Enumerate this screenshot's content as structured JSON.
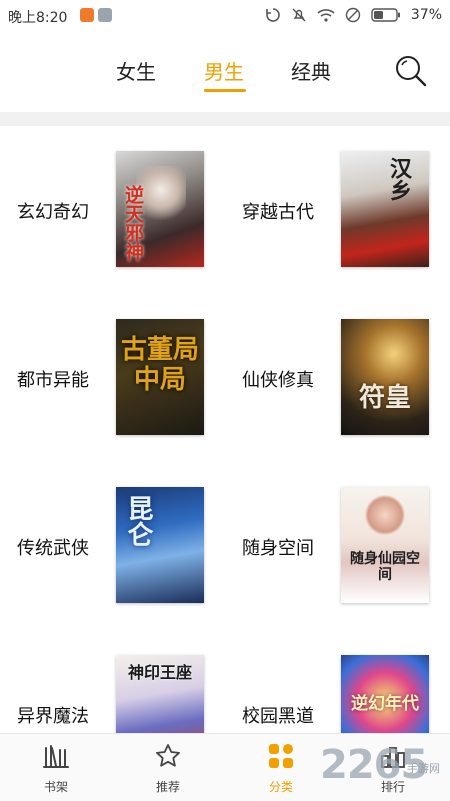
{
  "status": {
    "time": "晚上8:20",
    "battery": "37%"
  },
  "tabs": [
    {
      "label": "女生",
      "active": false
    },
    {
      "label": "男生",
      "active": true
    },
    {
      "label": "经典",
      "active": false
    }
  ],
  "categories": [
    {
      "label": "玄幻奇幻",
      "cover_title": "逆天邪神"
    },
    {
      "label": "穿越古代",
      "cover_title": "汉乡"
    },
    {
      "label": "都市异能",
      "cover_title": "古董局中局"
    },
    {
      "label": "仙侠修真",
      "cover_title": "符皇"
    },
    {
      "label": "传统武侠",
      "cover_title": "昆仑"
    },
    {
      "label": "随身空间",
      "cover_title": "随身仙园空间"
    },
    {
      "label": "异界魔法",
      "cover_title": "神印王座"
    },
    {
      "label": "校园黑道",
      "cover_title": "逆幻年代"
    }
  ],
  "bottom_nav": [
    {
      "label": "书架",
      "icon": "bookshelf-icon",
      "active": false
    },
    {
      "label": "推荐",
      "icon": "star-icon",
      "active": false
    },
    {
      "label": "分类",
      "icon": "grid-category-icon",
      "active": true
    },
    {
      "label": "排行",
      "icon": "ranking-icon",
      "active": false
    }
  ],
  "watermark": {
    "main": "2265",
    "sub": "手游网"
  },
  "colors": {
    "accent": "#f2a000",
    "text": "#222222",
    "divider": "#f1f1f1"
  }
}
